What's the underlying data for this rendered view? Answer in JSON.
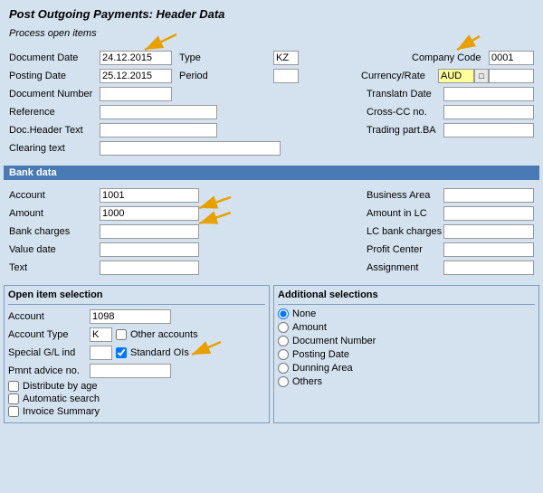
{
  "title": "Post Outgoing Payments: Header Data",
  "process_label": "Process open items",
  "header": {
    "document_date_label": "Document Date",
    "document_date_value": "24.12.2015",
    "type_label": "Type",
    "type_value": "KZ",
    "company_code_label": "Company Code",
    "company_code_value": "0001",
    "posting_date_label": "Posting Date",
    "posting_date_value": "25.12.2015",
    "period_label": "Period",
    "period_value": "",
    "currency_rate_label": "Currency/Rate",
    "currency_rate_value": "AUD",
    "document_number_label": "Document Number",
    "document_number_value": "",
    "translatn_date_label": "Translatn Date",
    "translatn_date_value": "",
    "reference_label": "Reference",
    "reference_value": "",
    "cross_cc_label": "Cross-CC no.",
    "cross_cc_value": "",
    "doc_header_text_label": "Doc.Header Text",
    "doc_header_text_value": "",
    "trading_part_label": "Trading part.BA",
    "trading_part_value": "",
    "clearing_text_label": "Clearing text",
    "clearing_text_value": ""
  },
  "bank_data": {
    "section_title": "Bank data",
    "account_label": "Account",
    "account_value": "1001",
    "business_area_label": "Business Area",
    "business_area_value": "",
    "amount_label": "Amount",
    "amount_value": "1000",
    "amount_lc_label": "Amount in LC",
    "amount_lc_value": "",
    "bank_charges_label": "Bank charges",
    "bank_charges_value": "",
    "lc_bank_charges_label": "LC bank charges",
    "lc_bank_charges_value": "",
    "value_date_label": "Value date",
    "value_date_value": "",
    "profit_center_label": "Profit Center",
    "profit_center_value": "",
    "text_label": "Text",
    "text_value": "",
    "assignment_label": "Assignment",
    "assignment_value": ""
  },
  "open_item": {
    "section_title": "Open item selection",
    "account_label": "Account",
    "account_value": "1098",
    "account_type_label": "Account Type",
    "account_type_value": "K",
    "other_accounts_label": "Other accounts",
    "other_accounts_checked": false,
    "special_gl_label": "Special G/L ind",
    "special_gl_value": "",
    "standard_ois_label": "Standard OIs",
    "standard_ois_checked": true,
    "pmnt_advice_label": "Pmnt advice no.",
    "pmnt_advice_value": "",
    "distribute_by_age_label": "Distribute by age",
    "distribute_by_age_checked": false,
    "automatic_search_label": "Automatic search",
    "automatic_search_checked": false,
    "invoice_summary_label": "Invoice Summary",
    "invoice_summary_checked": false
  },
  "additional": {
    "section_title": "Additional selections",
    "none_label": "None",
    "none_checked": true,
    "amount_label": "Amount",
    "amount_checked": false,
    "document_number_label": "Document Number",
    "document_number_checked": false,
    "posting_date_label": "Posting Date",
    "posting_date_checked": false,
    "dunning_area_label": "Dunning Area",
    "dunning_area_checked": false,
    "others_label": "Others",
    "others_checked": false
  }
}
